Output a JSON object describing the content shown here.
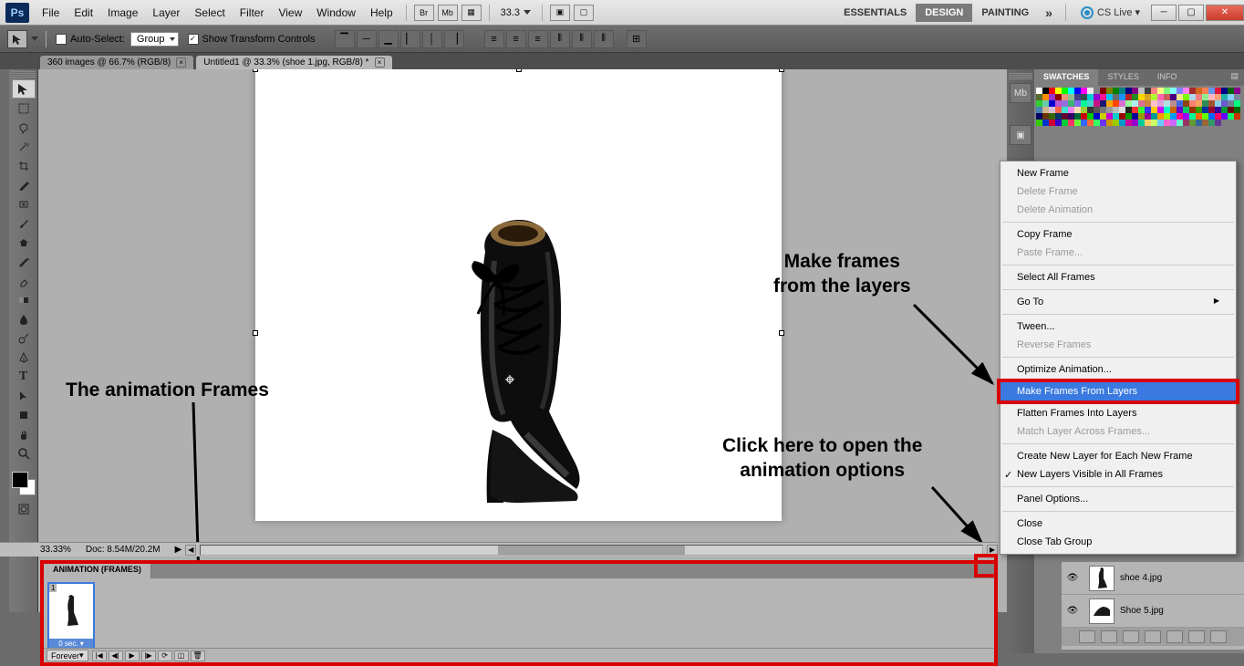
{
  "menu": {
    "items": [
      "File",
      "Edit",
      "Image",
      "Layer",
      "Select",
      "Filter",
      "View",
      "Window",
      "Help"
    ]
  },
  "topbar_icons": {
    "br": "Br",
    "mb": "Mb"
  },
  "zoom_top": "33.3",
  "workspaces": {
    "essentials": "ESSENTIALS",
    "design": "DESIGN",
    "painting": "PAINTING"
  },
  "cslive": "CS Live",
  "options": {
    "auto_select": "Auto-Select:",
    "group": "Group",
    "show_transform": "Show Transform Controls"
  },
  "doc_tabs": [
    {
      "label": "360 images @ 66.7% (RGB/8)"
    },
    {
      "label": "Untitled1 @ 33.3% (shoe 1.jpg, RGB/8) *"
    }
  ],
  "panel_tabs": {
    "swatches": "SWATCHES",
    "styles": "STYLES",
    "info": "INFO"
  },
  "status": {
    "zoom": "33.33%",
    "doc": "Doc: 8.54M/20.2M"
  },
  "animation": {
    "title": "ANIMATION (FRAMES)",
    "frame_num": "1",
    "frame_time": "0 sec.",
    "loop": "Forever"
  },
  "context_menu": {
    "new_frame": "New Frame",
    "delete_frame": "Delete Frame",
    "delete_animation": "Delete Animation",
    "copy_frame": "Copy Frame",
    "paste_frame": "Paste Frame...",
    "select_all": "Select All Frames",
    "go_to": "Go To",
    "tween": "Tween...",
    "reverse": "Reverse Frames",
    "optimize": "Optimize Animation...",
    "make_frames": "Make Frames From Layers",
    "flatten": "Flatten Frames Into Layers",
    "match_layer": "Match Layer Across Frames...",
    "create_layer": "Create New Layer for Each New Frame",
    "new_visible": "New Layers Visible in All Frames",
    "panel_options": "Panel Options...",
    "close": "Close",
    "close_tab_group": "Close Tab Group"
  },
  "annotations": {
    "frames": "The animation Frames",
    "make_layers_l1": "Make frames",
    "make_layers_l2": "from the layers",
    "click_here_l1": "Click here to open the",
    "click_here_l2": "animation options"
  },
  "layers": [
    {
      "name": "shoe 4.jpg"
    },
    {
      "name": "Shoe 5.jpg"
    }
  ],
  "swatch_colors": [
    "#ffffff",
    "#000000",
    "#ff0000",
    "#ffff00",
    "#00ff00",
    "#00ffff",
    "#0000ff",
    "#ff00ff",
    "#e8e8e8",
    "#808080",
    "#800000",
    "#808000",
    "#008000",
    "#008080",
    "#000080",
    "#800080",
    "#c0c0c0",
    "#404040",
    "#ff8080",
    "#ffff80",
    "#80ff80",
    "#80ffff",
    "#8080ff",
    "#ff80ff",
    "#a52a2a",
    "#d2691e",
    "#ff7f50",
    "#6495ed",
    "#dc143c",
    "#00008b",
    "#006400",
    "#8b008b",
    "#556b2f",
    "#ff8c00",
    "#9932cc",
    "#8b0000",
    "#e9967a",
    "#8fbc8f",
    "#483d8b",
    "#2f4f4f",
    "#00ced1",
    "#9400d3",
    "#ff1493",
    "#00bfff",
    "#696969",
    "#1e90ff",
    "#b22222",
    "#228b22",
    "#ffd700",
    "#daa520",
    "#adff2f",
    "#ff69b4",
    "#cd5c5c",
    "#4b0082",
    "#f0e68c",
    "#7cfc00",
    "#add8e6",
    "#f08080",
    "#90ee90",
    "#ffb6c1",
    "#ffa07a",
    "#20b2aa",
    "#87cefa",
    "#778899",
    "#32cd32",
    "#66cdaa",
    "#0000cd",
    "#ba55d3",
    "#9370db",
    "#3cb371",
    "#7b68ee",
    "#00fa9a",
    "#48d1cc",
    "#c71585",
    "#191970",
    "#ffa500",
    "#ff4500",
    "#da70d6",
    "#98fb98",
    "#afeeee",
    "#db7093",
    "#cd853f",
    "#ffc0cb",
    "#dda0dd",
    "#b0e0e6",
    "#bc8f8f",
    "#4169e1",
    "#8b4513",
    "#fa8072",
    "#f4a460",
    "#2e8b57",
    "#a0522d",
    "#87ceeb",
    "#6a5acd",
    "#708090",
    "#00ff7f",
    "#4682b4",
    "#d2b48c",
    "#d8bfd8",
    "#ff6347",
    "#40e0d0",
    "#ee82ee",
    "#f5deb3",
    "#9acd32",
    "#333333",
    "#555555",
    "#777777",
    "#999999",
    "#bbbbbb",
    "#dddddd",
    "#222222",
    "#ff3030",
    "#30ff30",
    "#3030ff",
    "#ffcc00",
    "#cc00ff",
    "#00ffcc",
    "#cc6600",
    "#6600cc",
    "#00cc66",
    "#993300",
    "#339900",
    "#003399",
    "#990033",
    "#330099",
    "#009933",
    "#660000",
    "#006600",
    "#000066",
    "#663300",
    "#336600",
    "#003366",
    "#660033",
    "#330066",
    "#006633",
    "#cc0000",
    "#00cc00",
    "#0000cc",
    "#cccc00",
    "#cc00cc",
    "#00cccc",
    "#990000",
    "#009900",
    "#000099",
    "#999900",
    "#990099",
    "#009999",
    "#ff9900",
    "#99ff00",
    "#0099ff",
    "#ff0099",
    "#9900ff",
    "#00ff99",
    "#ff6600",
    "#66ff00",
    "#0066ff",
    "#ff0066",
    "#6600ff",
    "#00ff66",
    "#cc3300",
    "#33cc00",
    "#0033cc",
    "#cc0033",
    "#3300cc",
    "#00cc33",
    "#ff3366",
    "#66ff33",
    "#3366ff",
    "#ff6633",
    "#33ff66",
    "#6633ff",
    "#cc9900",
    "#99cc00",
    "#0099cc",
    "#cc0099",
    "#9900cc",
    "#00cc99",
    "#ffcc66",
    "#ccff66",
    "#66ccff",
    "#ff66cc",
    "#cc66ff",
    "#66ffcc",
    "#993366",
    "#669933",
    "#336699",
    "#996633",
    "#339966",
    "#663399"
  ]
}
